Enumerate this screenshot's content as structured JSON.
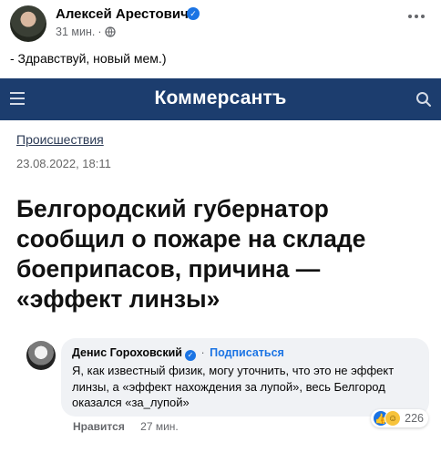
{
  "post": {
    "author": "Алексей Арестович",
    "time": "31 мин.",
    "separator": "·",
    "text": "- Здравствуй, новый мем.)"
  },
  "article": {
    "site_logo": "Коммерсантъ",
    "category": "Происшествия",
    "date": "23.08.2022, 18:11",
    "headline": "Белгородский губернатор сообщил о пожаре на складе боеприпасов, причина — «эффект линзы»"
  },
  "comment": {
    "author": "Денис Гороховский",
    "separator": "·",
    "follow_label": "Подписаться",
    "text": "Я, как известный физик, могу уточнить, что это не эффект линзы, а «эффект нахождения за лупой», весь Белгород оказался «за_лупой»",
    "like_label": "Нравится",
    "time": "27 мин.",
    "reaction_count": "226"
  },
  "colors": {
    "facebook_blue": "#1b74e4",
    "kommersant_bar": "#1c3d6e",
    "bubble_bg": "#f0f2f5"
  },
  "icons": {
    "verified": "verified-badge-icon",
    "globe": "globe-icon",
    "more": "more-options-icon",
    "menu": "hamburger-menu-icon",
    "search": "search-icon",
    "like_reaction": "like-reaction-icon",
    "haha_reaction": "haha-reaction-icon"
  }
}
